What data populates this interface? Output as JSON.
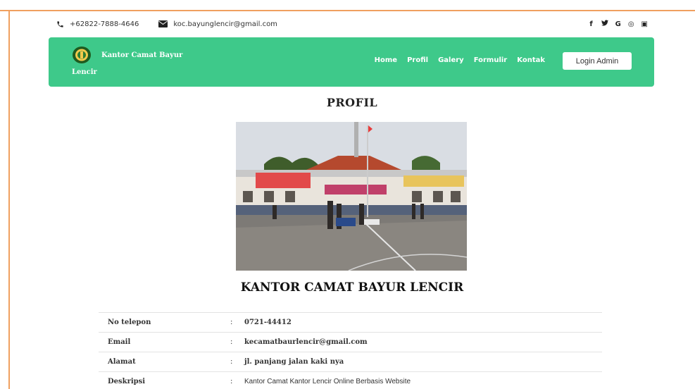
{
  "topbar": {
    "phone": "+62822-7888-4646",
    "email": "koc.bayunglencir@gmail.com",
    "social": [
      {
        "icon": "facebook-icon",
        "glyph": "f"
      },
      {
        "icon": "twitter-icon",
        "glyph": "✉"
      },
      {
        "icon": "google-icon",
        "glyph": "G"
      },
      {
        "icon": "instagram-icon",
        "glyph": "◎"
      },
      {
        "icon": "youtube-icon",
        "glyph": "▣"
      }
    ]
  },
  "brand": {
    "line1": "Kantor Camat Bayur",
    "line2": "Lencir"
  },
  "nav": {
    "items": [
      "Home",
      "Profil",
      "Galery",
      "Formulir",
      "Kontak"
    ],
    "login_label": "Login Admin"
  },
  "page": {
    "title": "PROFIL",
    "org_title": "KANTOR CAMAT BAYUR LENCIR"
  },
  "info": [
    {
      "label": "No telepon",
      "value": "0721-44412"
    },
    {
      "label": "Email",
      "value": "kecamatbaurlencir@gmail.com"
    },
    {
      "label": "Alamat",
      "value": "jl. panjang jalan kaki nya"
    },
    {
      "label": "Deskripsi",
      "value": "Kantor Camat Kantor Lencir Online Berbasis Website"
    }
  ],
  "colors": {
    "accent": "#3ec98a",
    "frame": "#f0a060"
  }
}
